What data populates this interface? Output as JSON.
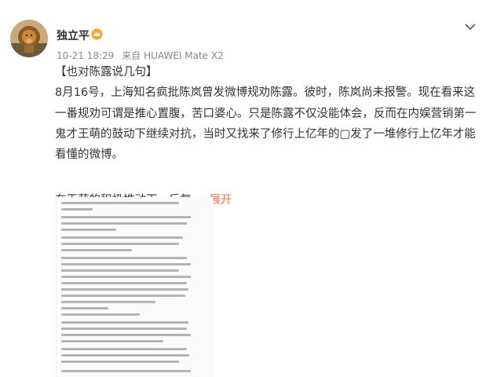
{
  "post": {
    "username": "独立平",
    "timestamp": "10-21 18:29",
    "source_prefix": "来自",
    "source": "HUAWEI Mate X2",
    "title": "【也对陈露说几句】",
    "paragraph1": "8月16号，上海知名疯批陈岚曾发微博规劝陈露。彼时，陈岚尚未报警。现在看来这一番规劝可谓是推心置腹，苦口婆心。只是陈露不仅没能体会，反而在内娱营销第一鬼才王萌的鼓动下继续对抗，当时又找来了修行上亿年的▢发了一堆修行上亿年才能看懂的微博。",
    "paragraph2": "在王萌的积极推动下，反复",
    "ellipsis": "...",
    "expand_label": "展开"
  },
  "icons": {
    "avatar": "lion-avatar",
    "badge": "vip-crown-icon",
    "menu": "chevron-down-icon"
  },
  "colors": {
    "text": "#333333",
    "meta": "#8a8a8a",
    "link": "#eb7350",
    "badge": "#f5a623"
  }
}
